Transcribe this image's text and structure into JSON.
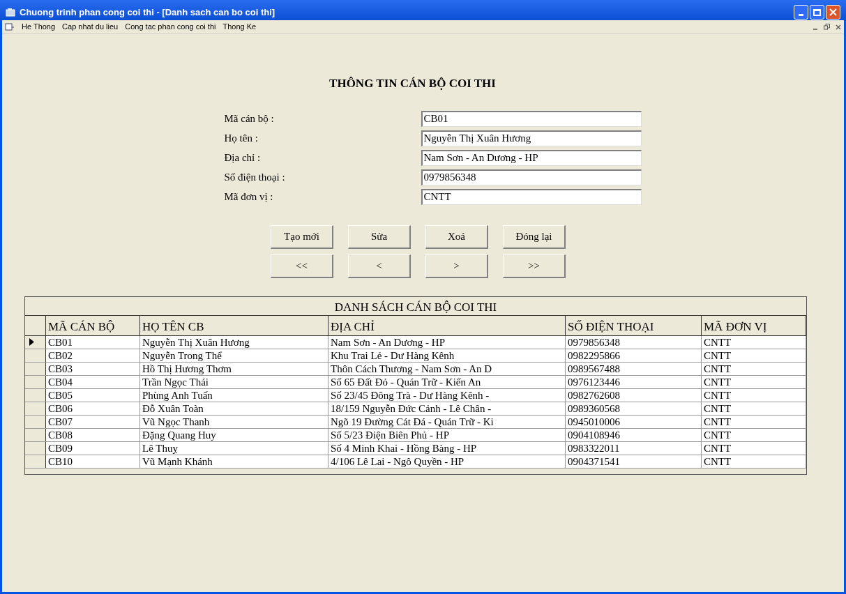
{
  "window": {
    "title": "Chuong trinh phan cong coi thi - [Danh sach can bo coi thi]"
  },
  "menu": [
    "He Thong",
    "Cap nhat du lieu",
    "Cong tac phan cong coi thi",
    "Thong Ke"
  ],
  "form": {
    "title": "THÔNG TIN CÁN BỘ COI THI",
    "fields": [
      {
        "label": "Mã cán bộ :",
        "value": "CB01"
      },
      {
        "label": "Họ tên :",
        "value": "Nguyễn Thị Xuân Hương"
      },
      {
        "label": "Địa chỉ :",
        "value": "Nam Sơn - An Dương - HP"
      },
      {
        "label": "Số điện thoại :",
        "value": "0979856348"
      },
      {
        "label": "Mã đơn vị :",
        "value": "CNTT"
      }
    ],
    "action_buttons": [
      "Tạo mới",
      "Sửa",
      "Xoá",
      "Đóng lại"
    ],
    "nav_buttons": [
      "<<",
      "<",
      ">",
      ">>"
    ]
  },
  "table": {
    "title": "DANH SÁCH CÁN BỘ COI THI",
    "columns": [
      "MÃ CÁN BỘ",
      "HỌ TÊN CB",
      "ĐỊA CHỈ",
      "SỐ ĐIỆN THOẠI",
      "MÃ ĐƠN VỊ"
    ],
    "rows": [
      {
        "selected": true,
        "cells": [
          "CB01",
          "Nguyễn Thị Xuân Hương",
          "Nam Sơn - An Dương - HP",
          "0979856348",
          "CNTT"
        ]
      },
      {
        "selected": false,
        "cells": [
          "CB02",
          "Nguyễn Trong Thể",
          "Khu Trai Lẻ - Dư Hàng Kênh",
          "0982295866",
          "CNTT"
        ]
      },
      {
        "selected": false,
        "cells": [
          "CB03",
          "Hồ Thị Hương Thơm",
          "Thôn Cách Thương - Nam Sơn - An D",
          "0989567488",
          "CNTT"
        ]
      },
      {
        "selected": false,
        "cells": [
          "CB04",
          "Trần Ngọc Thái",
          "Số 65 Đất Đỏ - Quán Trữ - Kiến An",
          "0976123446",
          "CNTT"
        ]
      },
      {
        "selected": false,
        "cells": [
          "CB05",
          "Phùng Anh Tuấn",
          "Số 23/45 Đông Trà - Dư Hàng Kênh -",
          "0982762608",
          "CNTT"
        ]
      },
      {
        "selected": false,
        "cells": [
          "CB06",
          "Đỗ Xuân Toàn",
          "18/159 Nguyễn Đức Cảnh - Lê Chân -",
          "0989360568",
          "CNTT"
        ]
      },
      {
        "selected": false,
        "cells": [
          "CB07",
          "Vũ Ngọc Thanh",
          "Ngõ 19 Đường Cát Đá - Quán Trữ - Ki",
          "0945010006",
          "CNTT"
        ]
      },
      {
        "selected": false,
        "cells": [
          "CB08",
          "Đặng Quang Huy",
          "Số 5/23 Điện Biên Phủ - HP",
          "0904108946",
          "CNTT"
        ]
      },
      {
        "selected": false,
        "cells": [
          "CB09",
          "Lê Thuỵ",
          "Số 4 Minh Khai - Hồng Bàng - HP",
          "0983322011",
          "CNTT"
        ]
      },
      {
        "selected": false,
        "cells": [
          "CB10",
          "Vũ Mạnh Khánh",
          "4/106 Lê Lai - Ngô Quyền - HP",
          "0904371541",
          "CNTT"
        ]
      }
    ]
  }
}
